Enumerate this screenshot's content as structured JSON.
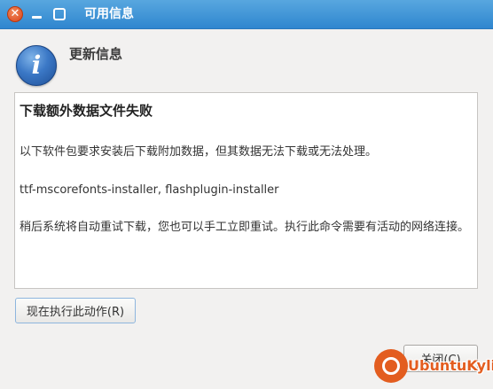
{
  "window": {
    "title": "可用信息"
  },
  "header": {
    "heading": "更新信息",
    "icon": "info-icon"
  },
  "message": {
    "title": "下载额外数据文件失败",
    "line1": "以下软件包要求安装后下载附加数据，但其数据无法下载或无法处理。",
    "line2": "ttf-mscorefonts-installer, flashplugin-installer",
    "line3": "稍后系统将自动重试下载，您也可以手工立即重试。执行此命令需要有活动的网络连接。"
  },
  "buttons": {
    "run_now": "现在执行此动作(R)",
    "close": "关闭(C)"
  },
  "watermark": {
    "text": "UbuntuKylin"
  },
  "colors": {
    "titlebar": "#2f86cf",
    "close_button": "#d9431a",
    "watermark": "#e35d1f"
  }
}
